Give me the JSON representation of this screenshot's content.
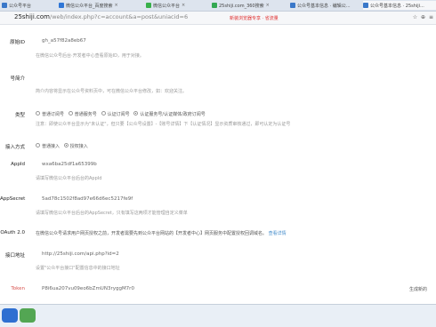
{
  "tabs": [
    {
      "label": "公众号平台",
      "color": "#3a78c9"
    },
    {
      "label": "微信公众平台_百度搜索",
      "color": "#2f76d6"
    },
    {
      "label": "微信公众平台",
      "color": "#38b04a"
    },
    {
      "label": "25shiji.com_360搜索",
      "color": "#33a852"
    },
    {
      "label": "公众号基本信息 · 编辑公...",
      "color": "#3a78c9"
    },
    {
      "label": "公众号基本信息 · 25shiji...",
      "color": "#3a78c9"
    }
  ],
  "address": {
    "domain": "25shiji.com",
    "path": "/web/index.php?c=account&a=post&uniacid=6",
    "promo": "新装浏览器专享 · 省流量",
    "tools": "☆ ⊕ ≡"
  },
  "form": {
    "original_id": {
      "label": "原始ID",
      "value": "gh_a57f82a8eb67",
      "help": "在微信公众号后台·开发者中心查看原始ID，用于对接。"
    },
    "intro": {
      "label": "号简介",
      "help": "简介内容将显示在公众号资料页中，可在微信公众平台修改，如：欢迎关注。"
    },
    "level": {
      "label": "类型",
      "options": [
        "普通订阅号",
        "普通服务号",
        "认证订阅号",
        "认证服务号/认证媒体/政府订阅号"
      ],
      "selected": 3,
      "help": "注意：即使公众平台显示为\"未认证\"，但只要【公众号设置】-【账号详情】下【认证情况】显示资质审核通过，即可认定为认证号"
    },
    "access_mode": {
      "label": "接入方式",
      "options": [
        "普通接入",
        "授权接入"
      ],
      "selected": 1
    },
    "appid": {
      "label": "AppId",
      "value": "wxa6ba25df1a65399b",
      "help": "请填写微信公众平台后台的AppId"
    },
    "appsecret": {
      "label": "AppSecret",
      "value": "5ad78c1502f8ad97e66d6ec5217fe9f",
      "help": "请填写微信公众平台后台的AppSecret，只有填写这两项才能管理自定义菜单"
    },
    "oauth": {
      "label": "OAuth 2.0",
      "text": "在微信公众号请求用户网页授权之前，开发者需要先到公众平台网站的【开发者中心】网页服务中配置授权回调域名。",
      "link": "查看详情"
    },
    "interface": {
      "label": "接口地址",
      "value": "http://25shiji.com/api.php?id=2",
      "help": "设置\"公众平台接口\"配置信息中的接口地址"
    },
    "token": {
      "label": "Token",
      "value": "P8i6ua207vu09eo6bZmUN3ryggM7r0",
      "action": "生成新的"
    }
  }
}
